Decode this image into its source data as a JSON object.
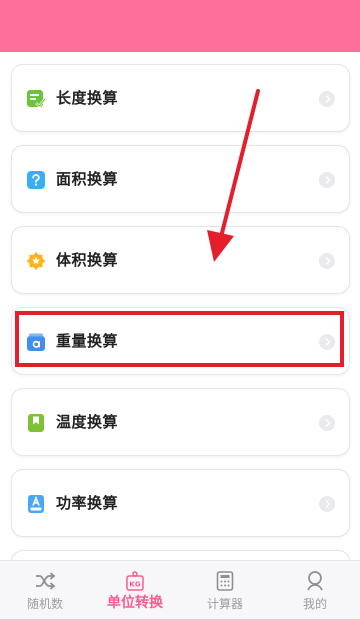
{
  "colors": {
    "header": "#fe6f99",
    "accent": "#fe5b8e",
    "highlight_box": "#e41e2a"
  },
  "list": {
    "items": [
      {
        "label": "长度换算",
        "icon": "length-icon",
        "color": "#6cc33c"
      },
      {
        "label": "面积换算",
        "icon": "question-square-icon",
        "color": "#3aaef5"
      },
      {
        "label": "体积换算",
        "icon": "star-badge-icon",
        "color": "#ffb21a"
      },
      {
        "label": "重量换算",
        "icon": "weight-icon",
        "color": "#3e8ff0"
      },
      {
        "label": "温度换算",
        "icon": "bookmark-icon",
        "color": "#7cc232"
      },
      {
        "label": "功率换算",
        "icon": "power-doc-icon",
        "color": "#4aa7f5"
      }
    ]
  },
  "tabs": [
    {
      "label": "随机数",
      "icon": "shuffle-icon",
      "active": false
    },
    {
      "label": "单位转换",
      "icon": "kg-weight-icon",
      "active": true
    },
    {
      "label": "计算器",
      "icon": "calculator-icon",
      "active": false
    },
    {
      "label": "我的",
      "icon": "user-icon",
      "active": false
    }
  ]
}
